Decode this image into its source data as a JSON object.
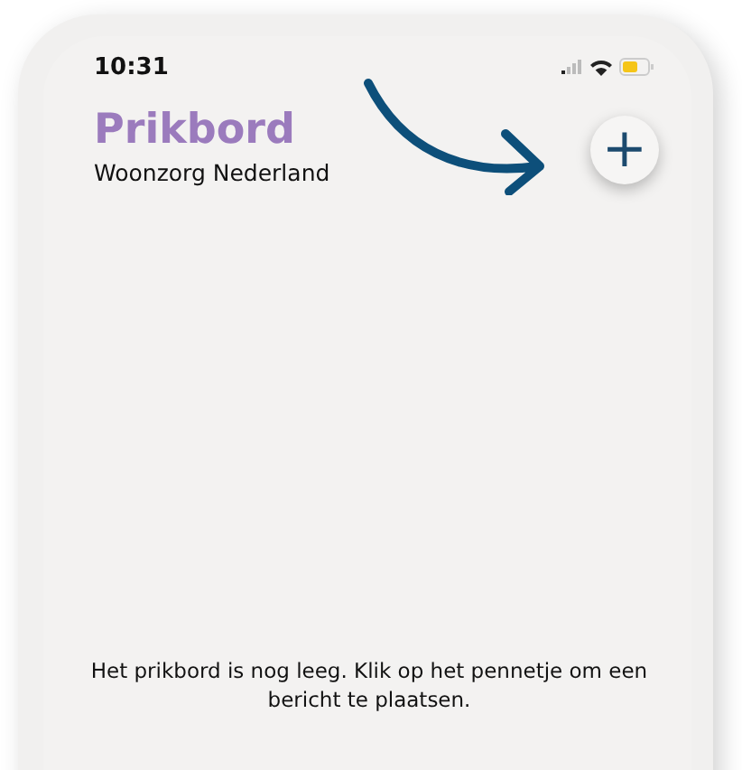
{
  "status_bar": {
    "time": "10:31"
  },
  "header": {
    "title": "Prikbord",
    "subtitle": "Woonzorg Nederland",
    "add_button": "+"
  },
  "empty_message": "Het prikbord is nog leeg. Klik op het pennetje om een bericht te plaatsen."
}
